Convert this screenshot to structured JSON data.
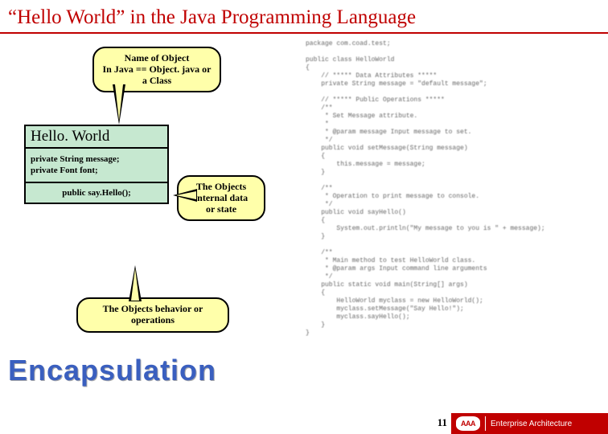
{
  "title": "“Hello World” in the Java Programming Language",
  "callouts": {
    "name": "Name of Object\nIn Java == Object. java or\na Class",
    "data": "The Objects\ninternal data\nor state",
    "ops": "The Objects behavior or\noperations"
  },
  "uml": {
    "head": "Hello. World",
    "attr1": "private String message;",
    "attr2": "private Font font;",
    "op1": "public say.Hello();"
  },
  "encapsulation": "Encapsulation",
  "code": "package com.coad.test;\n\npublic class HelloWorld\n{\n    // ***** Data Attributes *****\n    private String message = \"default message\";\n\n    // ***** Public Operations *****\n    /**\n     * Set Message attribute.\n     *\n     * @param message Input message to set.\n     */\n    public void setMessage(String message)\n    {\n        this.message = message;\n    }\n\n    /**\n     * Operation to print message to console.\n     */\n    public void sayHello()\n    {\n        System.out.println(\"My message to you is \" + message);\n    }\n\n    /**\n     * Main method to test HelloWorld class.\n     * @param args Input command line arguments\n     */\n    public static void main(String[] args)\n    {\n        HelloWorld myclass = new HelloWorld();\n        myclass.setMessage(\"Say Hello!\");\n        myclass.sayHello();\n    }\n}",
  "footer": {
    "page": "11",
    "logo": "AAA",
    "brand": "Enterprise Architecture"
  }
}
